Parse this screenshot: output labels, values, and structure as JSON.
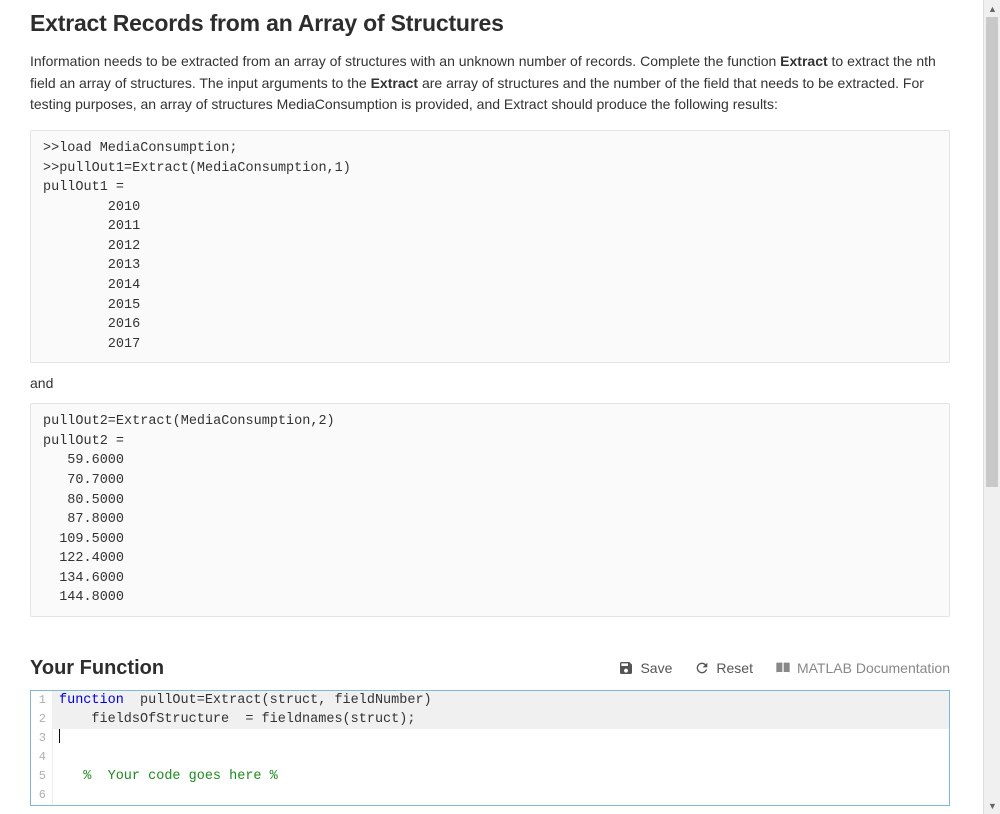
{
  "title": "Extract Records from an Array of Structures",
  "description": {
    "pre1": "Information needs to be extracted from an array of structures with an unknown number of records. Complete the function ",
    "bold1": "Extract",
    "mid1": " to extract the nth field an array of structures.  The input arguments to the ",
    "bold2": "Extract",
    "post1": " are array of structures and the number of the field that needs to be extracted.   For testing purposes, an array of structures MediaConsumption is provided, and Extract should produce the following results:"
  },
  "code1": ">>load MediaConsumption;\n>>pullOut1=Extract(MediaConsumption,1)\npullOut1 =\n        2010\n        2011\n        2012\n        2013\n        2014\n        2015\n        2016\n        2017",
  "and_text": "and",
  "code2": "pullOut2=Extract(MediaConsumption,2)\npullOut2 =\n   59.6000\n   70.7000\n   80.5000\n   87.8000\n  109.5000\n  122.4000\n  134.6000\n  144.8000",
  "section_heading": "Your Function",
  "toolbar": {
    "save_label": "Save",
    "reset_label": "Reset",
    "docs_label": "MATLAB Documentation"
  },
  "editor": {
    "lines": [
      {
        "n": "1",
        "type": "code",
        "hl": true,
        "tokens": [
          {
            "cls": "kw",
            "t": "function"
          },
          {
            "cls": "",
            "t": "  pullOut=Extract(struct, fieldNumber)"
          }
        ]
      },
      {
        "n": "2",
        "type": "code",
        "hl": true,
        "tokens": [
          {
            "cls": "",
            "t": "    fieldsOfStructure  = fieldnames(struct);"
          }
        ]
      },
      {
        "n": "3",
        "type": "cursor",
        "hl": false
      },
      {
        "n": "4",
        "type": "blank",
        "hl": false
      },
      {
        "n": "5",
        "type": "code",
        "hl": false,
        "tokens": [
          {
            "cls": "cm",
            "t": "   %  Your code goes here %"
          }
        ]
      },
      {
        "n": "6",
        "type": "blank",
        "hl": false
      }
    ]
  }
}
